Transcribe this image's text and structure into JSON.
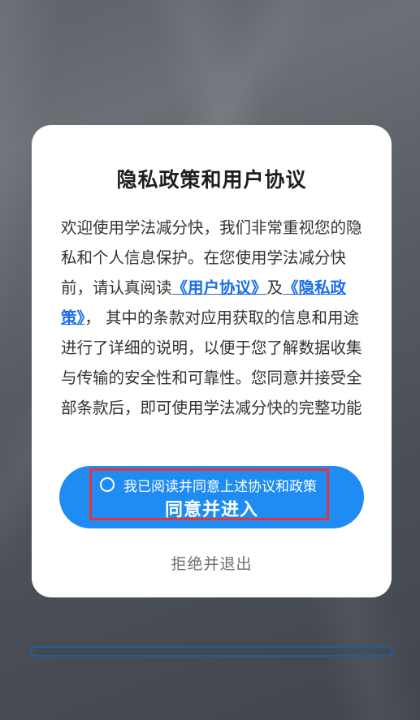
{
  "dialog": {
    "title": "隐私政策和用户协议",
    "body": {
      "part1": "欢迎使用学法减分快，我们非常重视您的隐私和个人信息保护。在您使用学法减分快前，请认真阅读",
      "link_user_agreement": "《用户协议》",
      "between": "及",
      "link_privacy_policy": "《隐私政策》",
      "part2": "， 其中的条款对应用获取的信息和用途进行了详细的说明，以便于您了解数据收集与传输的安全性和可靠性。您同意并接受全部条款后，即可使用学法减分快的完整功能"
    },
    "checkbox_label": "我已阅读并同意上述协议和政策",
    "agree_label": "同意并进入",
    "reject_label": "拒绝并退出"
  },
  "progress": {
    "fraction": 0
  },
  "colors": {
    "accent": "#1f8cf3",
    "link": "#1a6ee8",
    "highlight": "#e2343a"
  }
}
